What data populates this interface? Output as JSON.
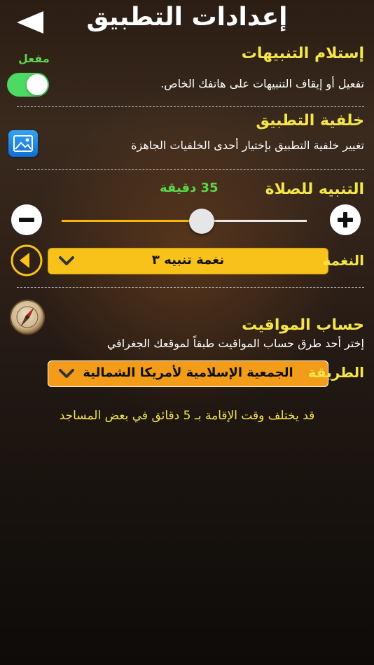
{
  "header": {
    "title": "إعدادات التطبيق"
  },
  "notifications": {
    "title": "إستلام التنبيهات",
    "description": "تفعيل أو إيقاف التنبيهات على هاتفك الخاص.",
    "toggle_status": "مفعل",
    "enabled": true
  },
  "background": {
    "title": "خلفية التطبيق",
    "description": "تغيير خلفية التطبيق بإختيار أحدى الخلفيات الجاهزة",
    "icon": "image-icon"
  },
  "prayer_alert": {
    "title": "التنبيه للصلاة",
    "value_label": "35 دقيقة",
    "level": 0.57,
    "tone_label": "النغمة",
    "tone_value": "نغمة تنبيه ٣"
  },
  "prayer_times": {
    "title": "حساب المواقيت",
    "description": "إختر أحد طرق حساب المواقيت طبقاً لموقعك الجغرافي",
    "method_label": "الطريقة",
    "method_value": "الجمعية الإسلامية لأمريكا الشمالية"
  },
  "note": "قد يختلف وقت الإقامة بـ 5 دقائق في بعض المساجد",
  "colors": {
    "accent_yellow": "#f4e54a",
    "toggle_green": "#4cd964",
    "slider_fill": "#f5b800",
    "tone_dropdown": "#f8c21a",
    "method_dropdown": "#f39c1a"
  }
}
